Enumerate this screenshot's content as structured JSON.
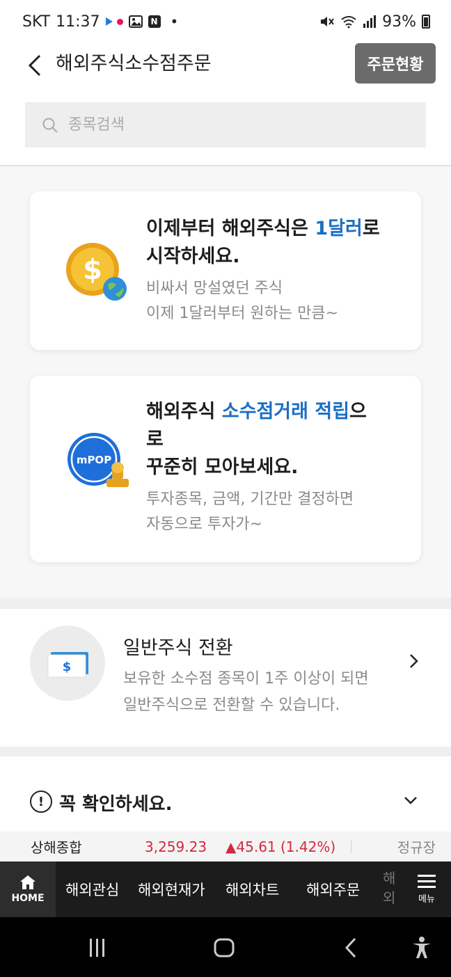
{
  "status_bar": {
    "carrier": "SKT",
    "time": "11:37",
    "battery": "93%",
    "notif_dot": "•"
  },
  "header": {
    "title": "해외주식소수점주문",
    "order_status_label": "주문현황"
  },
  "search": {
    "placeholder": "종목검색"
  },
  "cards": [
    {
      "headline_part1": "이제부터 해외주식은 ",
      "headline_accent": "1달러",
      "headline_part2": "로",
      "headline_line2": "시작하세요.",
      "sub_line1": "비싸서 망설였던 주식",
      "sub_line2": "이제 1달러부터 원하는 만큼~",
      "icon": "dollar-coin-globe-icon"
    },
    {
      "headline_part1": "해외주식 ",
      "headline_accent": "소수점거래 적립",
      "headline_part2": "으",
      "headline_line2": "로",
      "headline_line3": "꾸준히 모아보세요.",
      "sub_line1": "투자종목, 금액, 기간만 결정하면",
      "sub_line2": "자동으로 투자가~",
      "icon_text": "mPOP",
      "icon": "mpop-stamp-icon"
    }
  ],
  "convert": {
    "title": "일반주식 전환",
    "desc_line1": "보유한 소수점 종목이 1주 이상이 되면",
    "desc_line2": "일반주식으로 전환할 수 있습니다.",
    "icon": "dollar-bill-icon",
    "bill_symbol": "$"
  },
  "notice": {
    "title": "꼭 확인하세요.",
    "icon_glyph": "!"
  },
  "ticker": {
    "name": "상해종합",
    "price": "3,259.23",
    "change": "▲45.61 (1.42%)",
    "session": "정규장",
    "color_up": "#d7263d"
  },
  "bottom_nav": {
    "home_label": "HOME",
    "items": [
      "해외관심",
      "해외현재가",
      "해외차트",
      "해외주문"
    ],
    "cut_item": "해외잔고",
    "menu_label": "메뉴"
  },
  "colors": {
    "accent_blue": "#1b6fc4",
    "button_gray": "#6b6b6b",
    "nav_dark": "#1c1c1c"
  }
}
